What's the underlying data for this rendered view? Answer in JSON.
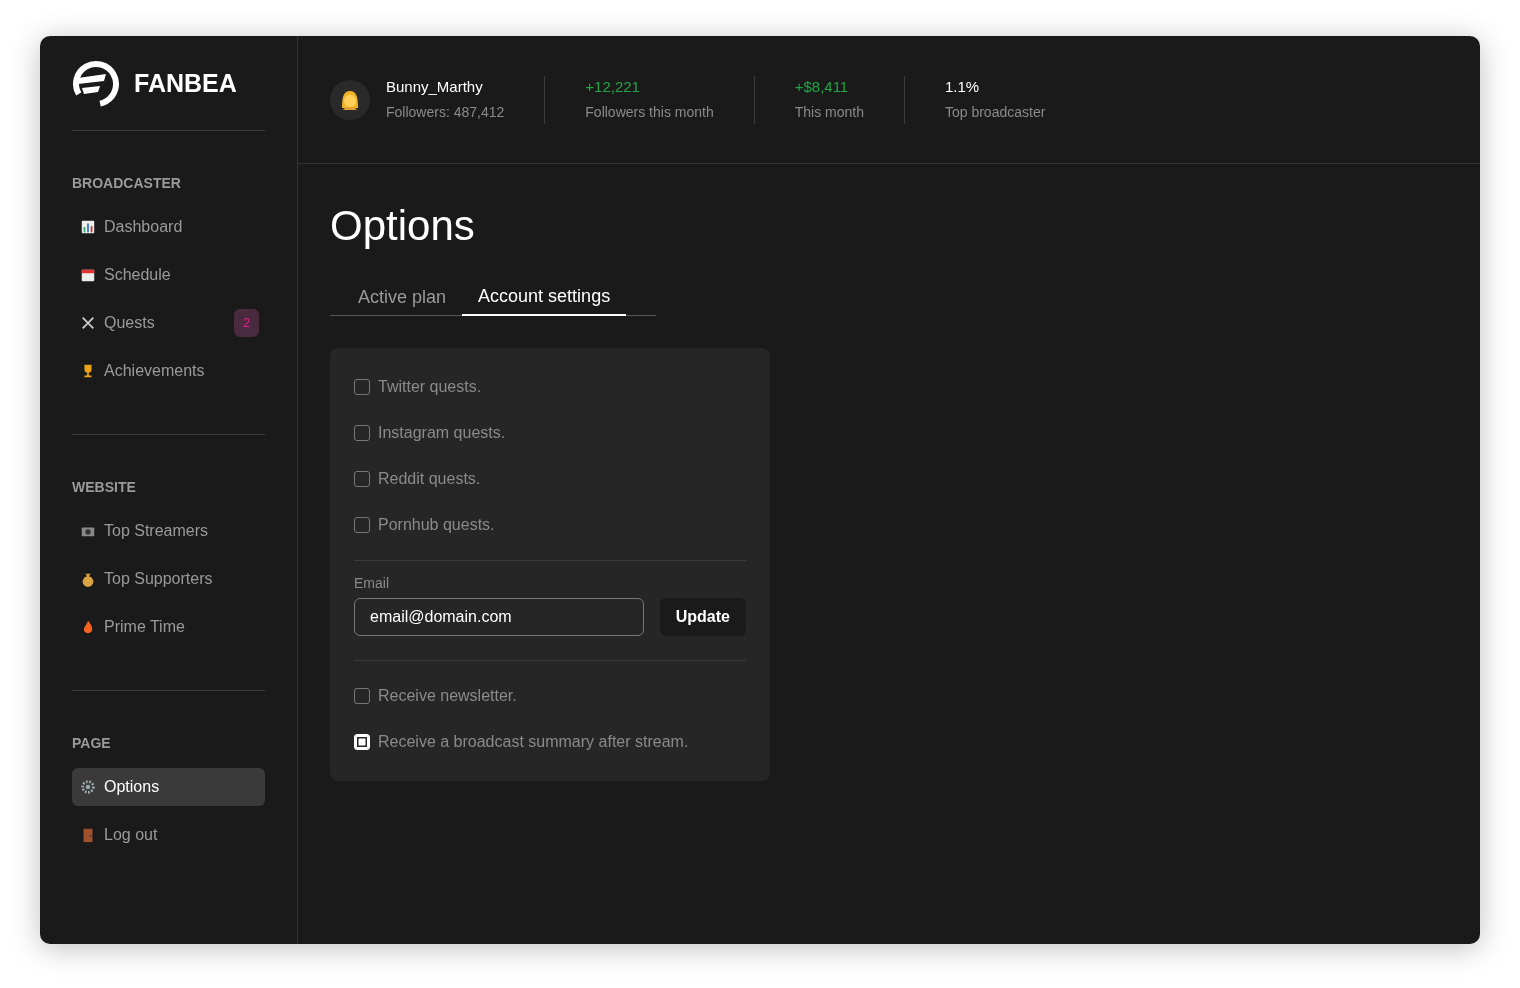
{
  "brand": {
    "name": "FANBEA"
  },
  "sidebar": {
    "sections": [
      {
        "title": "BROADCASTER",
        "items": [
          {
            "label": "Dashboard",
            "selected": false
          },
          {
            "label": "Schedule",
            "selected": false
          },
          {
            "label": "Quests",
            "selected": false,
            "badge": "2"
          },
          {
            "label": "Achievements",
            "selected": false
          }
        ]
      },
      {
        "title": "WEBSITE",
        "items": [
          {
            "label": "Top Streamers",
            "selected": false
          },
          {
            "label": "Top Supporters",
            "selected": false
          },
          {
            "label": "Prime Time",
            "selected": false
          }
        ]
      },
      {
        "title": "PAGE",
        "items": [
          {
            "label": "Options",
            "selected": true
          },
          {
            "label": "Log out",
            "selected": false
          }
        ]
      }
    ]
  },
  "header": {
    "user": {
      "name": "Bunny_Marthy",
      "followers": "Followers: 487,412"
    },
    "stats": [
      {
        "value": "+12,221",
        "label": "Followers this month",
        "color": "#22a447"
      },
      {
        "value": "+$8,411",
        "label": "This month",
        "color": "#22a447"
      },
      {
        "value": "1.1%",
        "label": "Top broadcaster",
        "color": "#ffffff"
      }
    ]
  },
  "page": {
    "title": "Options",
    "tabs": [
      {
        "label": "Active plan",
        "selected": false
      },
      {
        "label": "Account settings",
        "selected": true
      }
    ]
  },
  "settings": {
    "quest_options": [
      {
        "label": "Twitter quests.",
        "checked": false
      },
      {
        "label": "Instagram quests.",
        "checked": false
      },
      {
        "label": "Reddit quests.",
        "checked": false
      },
      {
        "label": "Pornhub quests.",
        "checked": false
      }
    ],
    "email": {
      "label": "Email",
      "value": "email@domain.com",
      "button": "Update"
    },
    "mail_options": [
      {
        "label": "Receive newsletter.",
        "checked": false
      },
      {
        "label": "Receive a broadcast summary after stream.",
        "checked": true
      }
    ]
  }
}
